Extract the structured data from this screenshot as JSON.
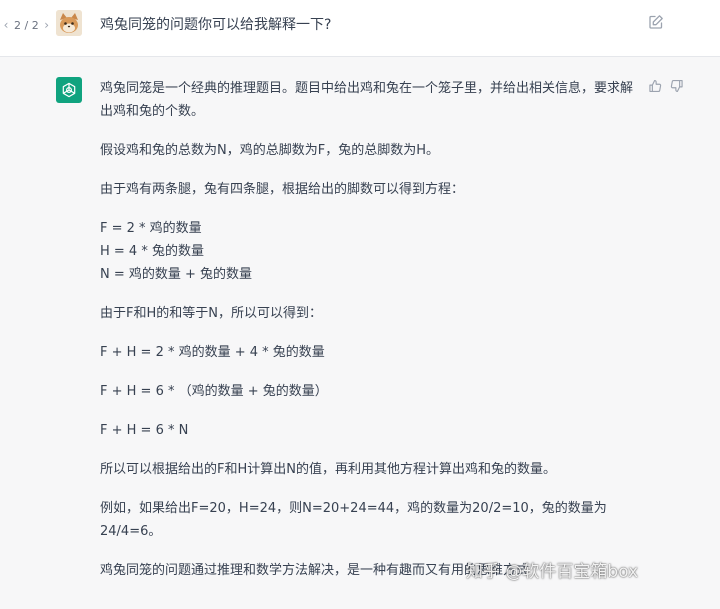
{
  "pager": {
    "prev": "‹",
    "count": "2 / 2",
    "next": "›"
  },
  "user_message": {
    "text": "鸡兔同笼的问题你可以给我解释一下?"
  },
  "assistant_message": {
    "paragraphs": [
      "鸡兔同笼是一个经典的推理题目。题目中给出鸡和兔在一个笼子里，并给出相关信息，要求解出鸡和兔的个数。",
      "假设鸡和兔的总数为N，鸡的总脚数为F，兔的总脚数为H。",
      "由于鸡有两条腿，兔有四条腿，根据给出的脚数可以得到方程：",
      "F = 2 * 鸡的数量",
      "H = 4 * 兔的数量",
      "N = 鸡的数量 + 兔的数量",
      "由于F和H的和等于N，所以可以得到：",
      "F + H = 2 * 鸡的数量 + 4 * 兔的数量",
      "F + H = 6 * （鸡的数量 + 兔的数量）",
      "F + H = 6 * N",
      "所以可以根据给出的F和H计算出N的值，再利用其他方程计算出鸡和兔的数量。",
      "例如，如果给出F=20，H=24，则N=20+24=44，鸡的数量为20/2=10，兔的数量为24/4=6。",
      "鸡兔同笼的问题通过推理和数学方法解决，是一种有趣而又有用的思维方式"
    ]
  },
  "watermark": {
    "text": "知乎 @软件百宝箱box"
  },
  "icons": {
    "edit": "edit-icon",
    "thumbs_up": "thumbs-up-icon",
    "thumbs_down": "thumbs-down-icon",
    "bot_logo": "openai-logo-icon"
  },
  "colors": {
    "assistant_bg": "#f7f7f8",
    "bot_avatar": "#10a37f",
    "text": "#374151",
    "muted": "#9ca3af"
  }
}
